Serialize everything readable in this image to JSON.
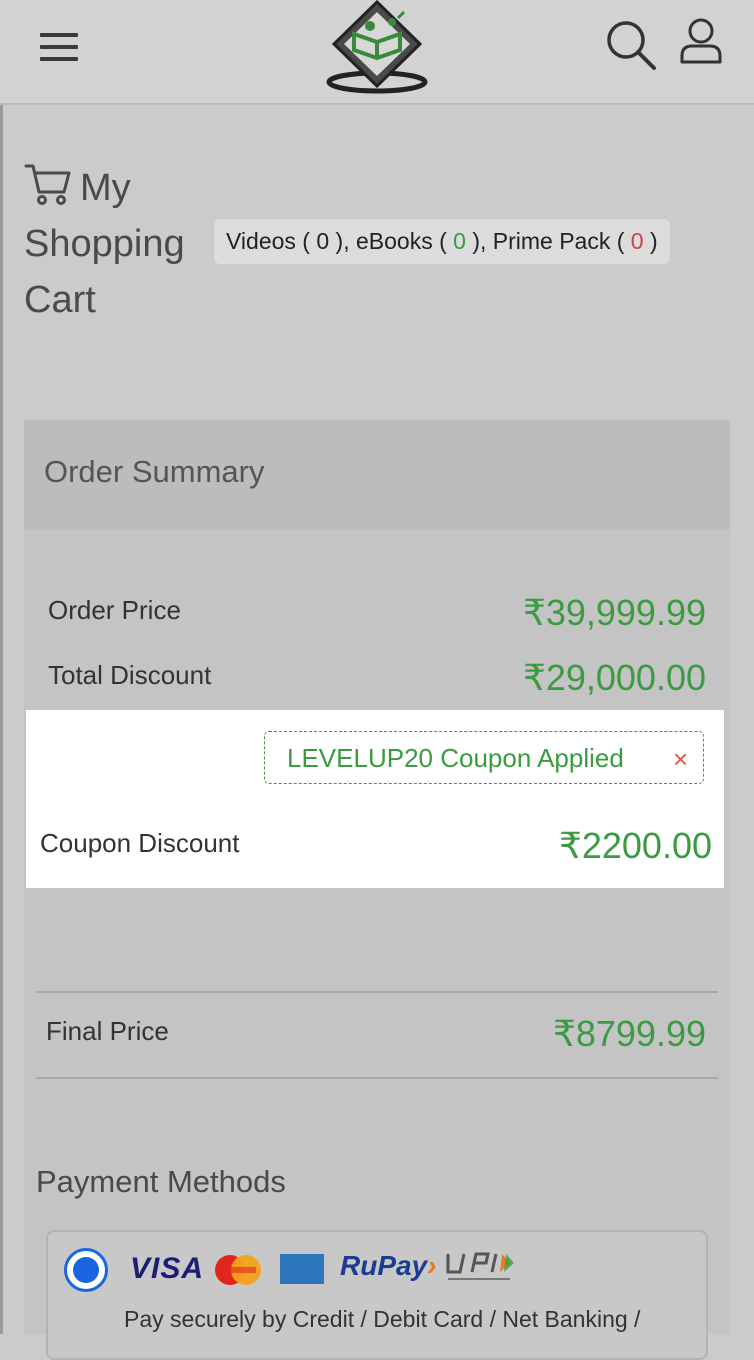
{
  "header": {
    "menu_icon": "hamburger-menu-icon",
    "logo": "tutorialspoint-logo",
    "search_icon": "search-icon",
    "user_icon": "user-icon"
  },
  "cart": {
    "icon": "shopping-cart-icon",
    "title_line1": "My",
    "title_line2": "Shopping",
    "title_line3": "Cart",
    "counts": {
      "videos_label": "Videos ( ",
      "videos_count": "0",
      "ebooks_label": " ), eBooks ( ",
      "ebooks_count": "0",
      "prime_label": " ), Prime Pack ( ",
      "prime_count": "0",
      "close": " )"
    }
  },
  "summary": {
    "heading": "Order Summary",
    "order_price_label": "Order Price",
    "order_price_value": "₹39,999.99",
    "total_discount_label": "Total Discount",
    "total_discount_value": "₹29,000.00",
    "coupon_tag": "LEVELUP20 Coupon Applied",
    "coupon_remove": "×",
    "coupon_discount_label": "Coupon Discount",
    "coupon_discount_value": "₹2200.00",
    "final_price_label": "Final Price",
    "final_price_value": "₹8799.99"
  },
  "payment": {
    "heading": "Payment Methods",
    "option": {
      "selected": true,
      "logos": [
        "VISA",
        "MasterCard",
        "American Express",
        "RuPay",
        "UPI"
      ],
      "visa": "VISA",
      "rupay_a": "RuPay",
      "rupay_b": "›",
      "description": "Pay securely by Credit / Debit Card / Net Banking /"
    }
  },
  "colors": {
    "accent_green": "#3b9b40",
    "accent_red": "#d2434a",
    "radio_blue": "#1a66e0"
  }
}
